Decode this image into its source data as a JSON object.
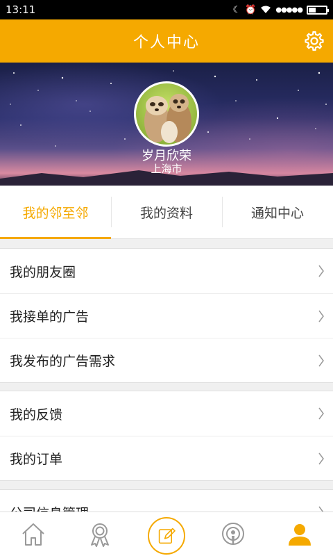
{
  "status_bar": {
    "time": "13:11"
  },
  "header": {
    "title": "个人中心"
  },
  "profile": {
    "username": "岁月欣荣",
    "city": "上海市"
  },
  "tabs": [
    {
      "label": "我的邻至邻",
      "active": true
    },
    {
      "label": "我的资料",
      "active": false
    },
    {
      "label": "通知中心",
      "active": false
    }
  ],
  "menu": {
    "group1": [
      "我的朋友圈",
      "我接单的广告",
      "我发布的广告需求"
    ],
    "group2": [
      "我的反馈",
      "我的订单"
    ],
    "group3": [
      "公司信息管理"
    ]
  },
  "colors": {
    "accent": "#f5a900"
  },
  "bottom_nav": {
    "icons": [
      "home-icon",
      "badge-icon",
      "compose-icon",
      "podcast-icon",
      "profile-icon"
    ],
    "active": "profile-icon"
  }
}
